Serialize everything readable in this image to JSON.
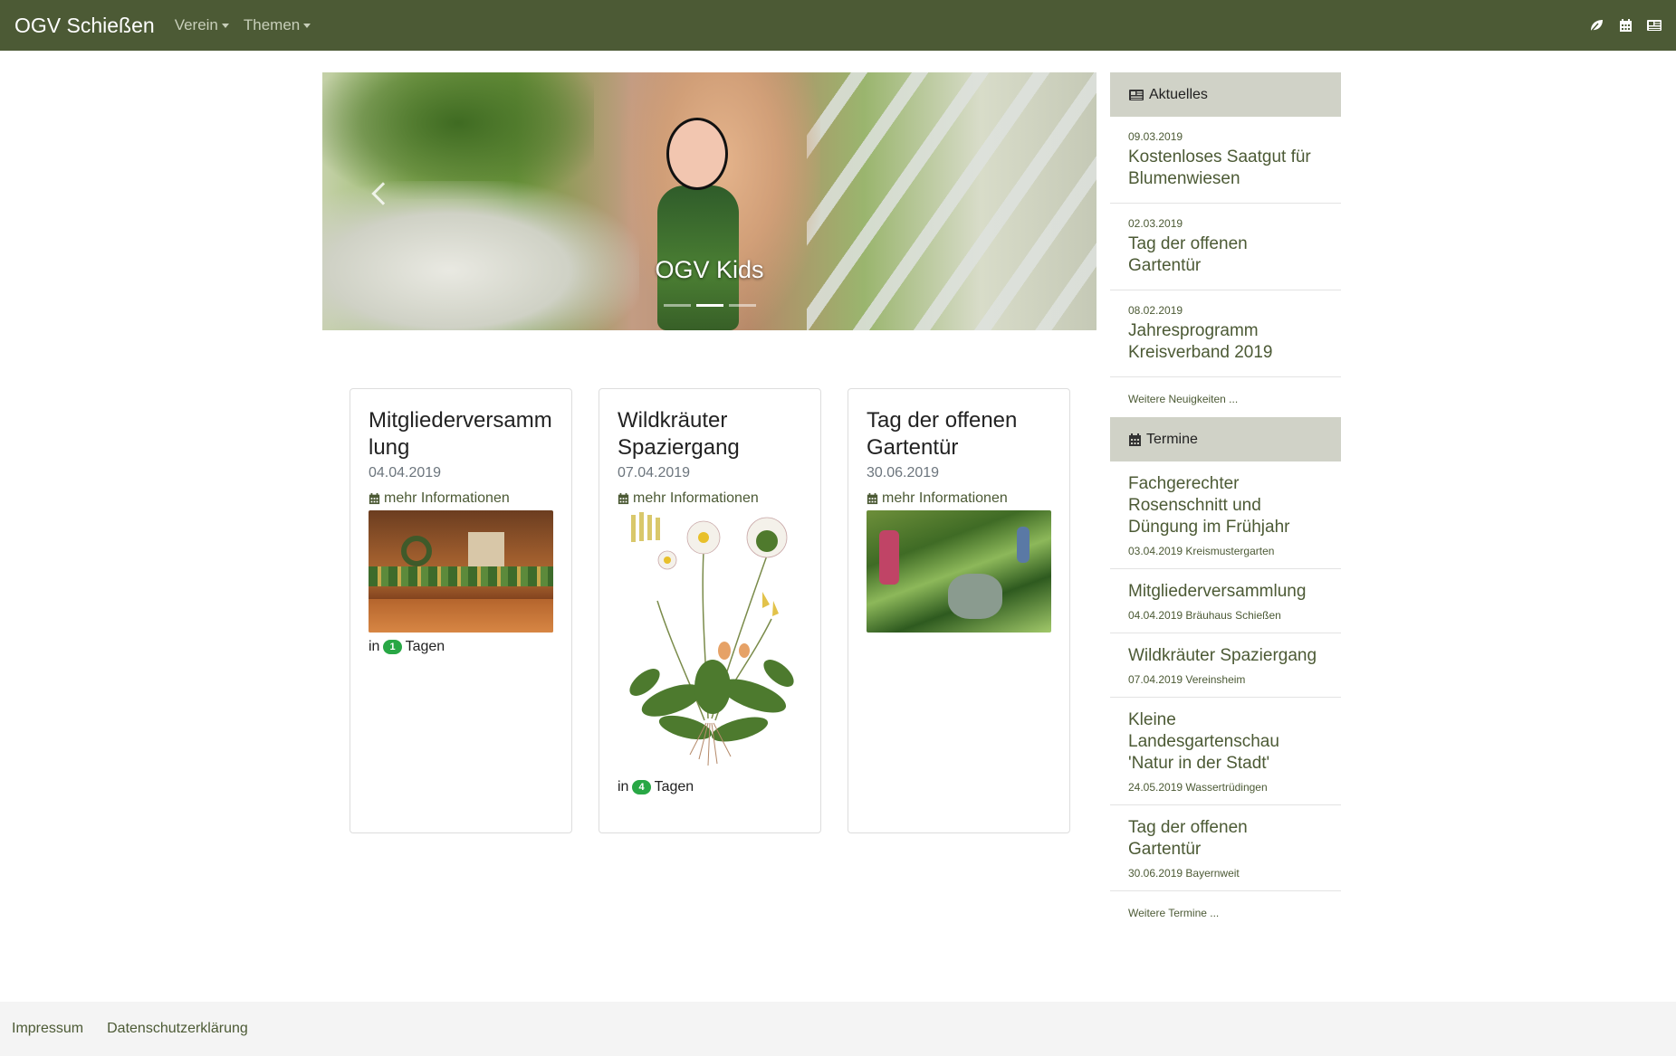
{
  "navbar": {
    "brand": "OGV Schießen",
    "menu": [
      {
        "label": "Verein"
      },
      {
        "label": "Themen"
      }
    ],
    "icons": [
      "leaf-icon",
      "calendar-icon",
      "newspaper-icon"
    ]
  },
  "carousel": {
    "caption": "OGV Kids",
    "indicators": 3,
    "active_index": 1
  },
  "cards": [
    {
      "title": "Mitgliederversammlung",
      "date": "04.04.2019",
      "link": "mehr Informationen",
      "days_prefix": "in",
      "days": "1",
      "days_suffix": "Tagen"
    },
    {
      "title": "Wildkräuter Spaziergang",
      "date": "07.04.2019",
      "link": "mehr Informationen",
      "days_prefix": "in",
      "days": "4",
      "days_suffix": "Tagen"
    },
    {
      "title": "Tag der offenen Gartentür",
      "date": "30.06.2019",
      "link": "mehr Informationen"
    }
  ],
  "sidebar": {
    "news_heading": "Aktuelles",
    "news": [
      {
        "date": "09.03.2019",
        "title": "Kostenloses Saatgut für Blumenwiesen"
      },
      {
        "date": "02.03.2019",
        "title": "Tag der offenen Gartentür"
      },
      {
        "date": "08.02.2019",
        "title": "Jahresprogramm Kreisverband 2019"
      }
    ],
    "news_more": "Weitere Neuigkeiten ...",
    "events_heading": "Termine",
    "events": [
      {
        "title": "Fachgerechter Rosenschnitt und Düngung im Frühjahr",
        "meta": "03.04.2019 Kreismustergarten"
      },
      {
        "title": "Mitgliederversammlung",
        "meta": "04.04.2019 Bräuhaus Schießen"
      },
      {
        "title": "Wildkräuter Spaziergang",
        "meta": "07.04.2019 Vereinsheim"
      },
      {
        "title": "Kleine Landesgartenschau 'Natur in der Stadt'",
        "meta": "24.05.2019 Wassertrüdingen"
      },
      {
        "title": "Tag der offenen Gartentür",
        "meta": "30.06.2019 Bayernweit"
      }
    ],
    "events_more": "Weitere Termine ..."
  },
  "footer": {
    "links": [
      "Impressum",
      "Datenschutzerklärung"
    ]
  },
  "colors": {
    "navbar": "#4c5a35",
    "sidebar_heading_bg": "#d0d2c7",
    "link": "#4c5a35",
    "badge": "#28a745",
    "footer_bg": "#f4f4f4"
  }
}
